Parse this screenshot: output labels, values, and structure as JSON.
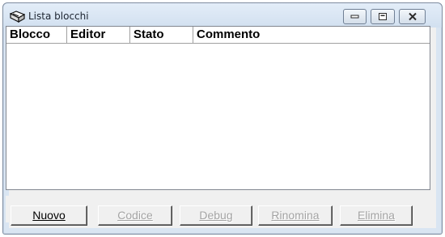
{
  "window": {
    "title": "Lista blocchi",
    "icon": "open-book-icon"
  },
  "caption_buttons": [
    {
      "name": "minimize",
      "icon": "minimize-icon"
    },
    {
      "name": "maximize",
      "icon": "maximize-icon"
    },
    {
      "name": "close",
      "icon": "close-icon"
    }
  ],
  "list": {
    "columns": [
      "Blocco",
      "Editor",
      "Stato",
      "Commento"
    ],
    "rows": []
  },
  "buttons": {
    "nuovo": {
      "label": "Nuovo",
      "enabled": true
    },
    "codice": {
      "label": "Codice",
      "enabled": false
    },
    "debug": {
      "label": "Debug",
      "enabled": false
    },
    "rinomina": {
      "label": "Rinomina",
      "enabled": false
    },
    "elimina": {
      "label": "Elimina",
      "enabled": false
    }
  }
}
